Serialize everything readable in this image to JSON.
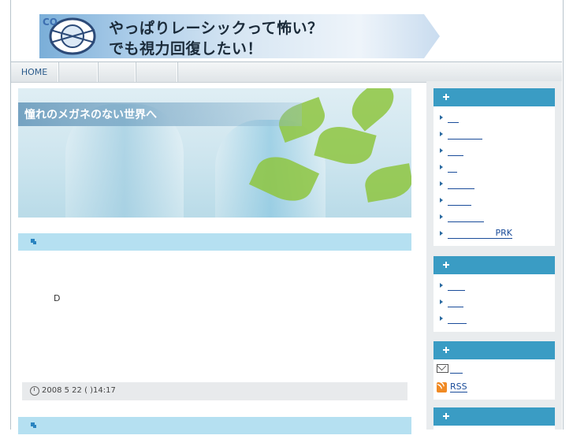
{
  "header": {
    "banner_line1": "やっぱりレーシックって怖い？",
    "banner_line2": "でも視力回復したい！"
  },
  "nav": {
    "items": [
      "HOME",
      "",
      "",
      ""
    ]
  },
  "main": {
    "hero_title": "憧れのメガネのない世界へ",
    "entry_text": "D",
    "entry_date": "2008 5 22 ( )14:17"
  },
  "sidebar": {
    "box1_links": [
      "",
      "",
      "",
      "",
      "",
      "",
      "",
      "PRK"
    ],
    "box2_links": [
      "",
      "",
      ""
    ],
    "box3": {
      "mail_label": "",
      "rss_label": "RSS"
    }
  },
  "colors": {
    "accent": "#3a9cc4",
    "section_bar": "#b5e0f1",
    "link": "#1a4c9a"
  }
}
